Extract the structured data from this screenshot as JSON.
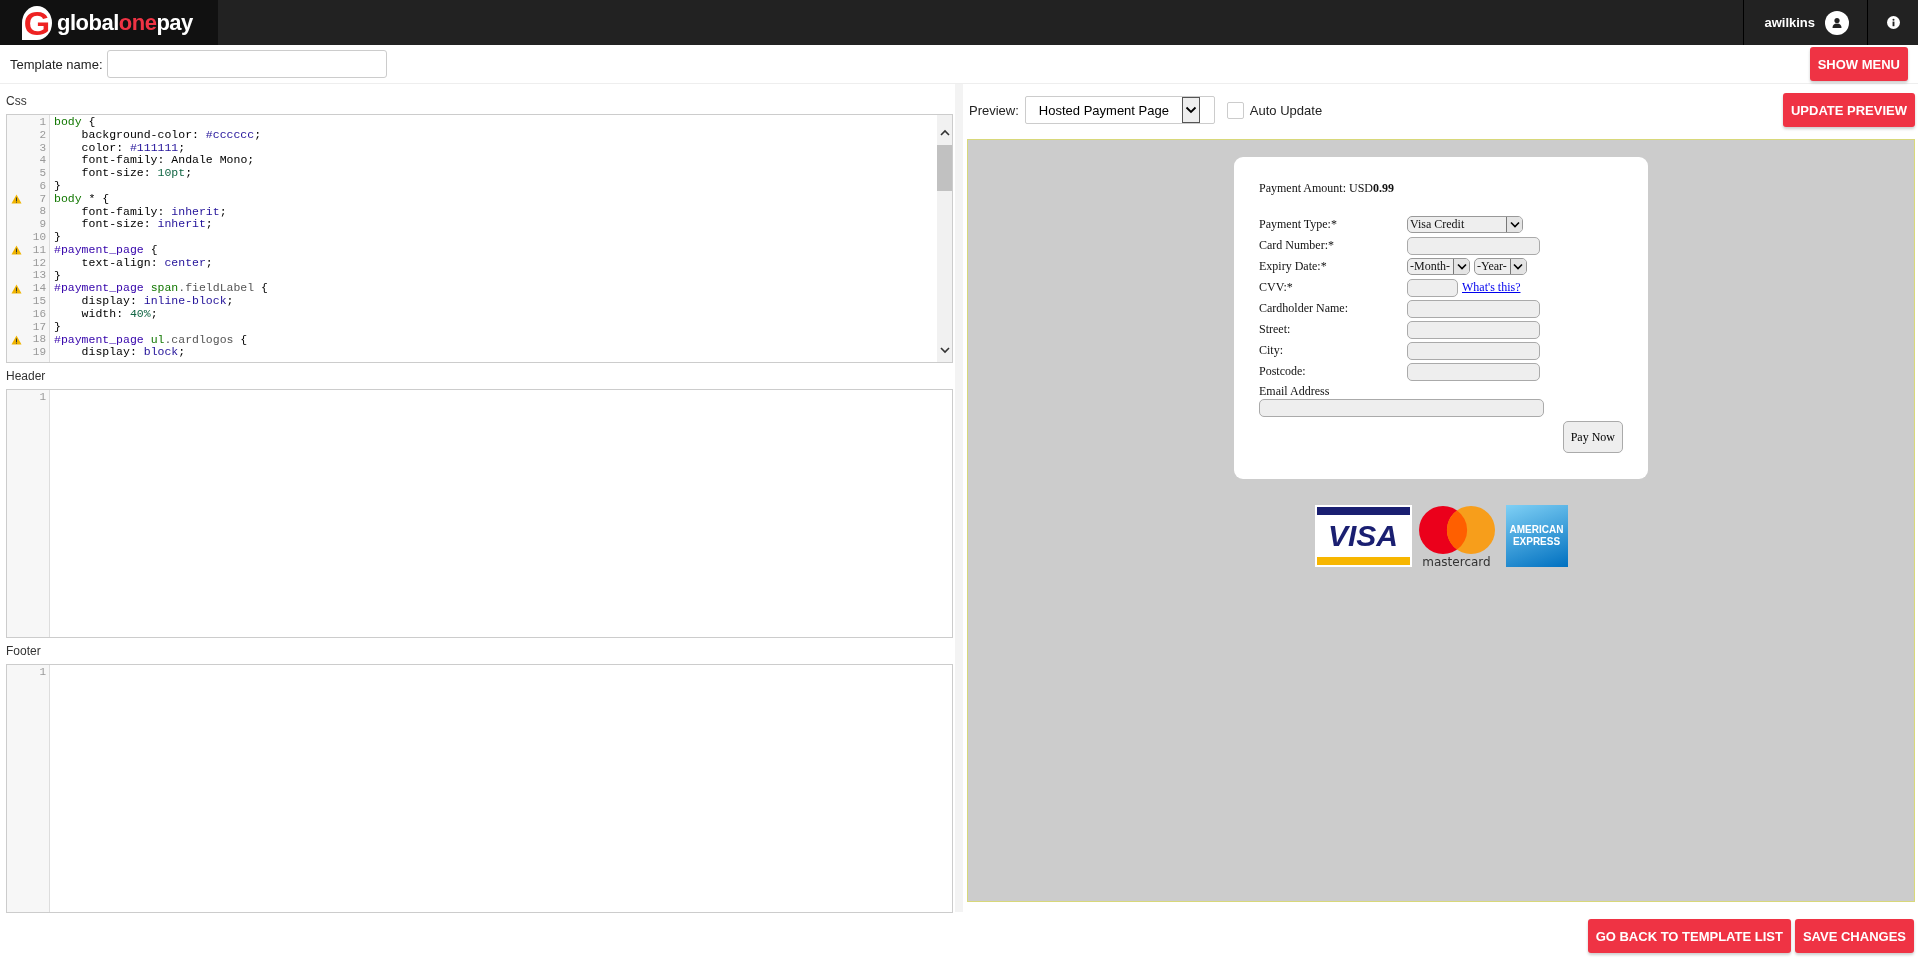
{
  "brand": {
    "logo_letter": "G",
    "parts": [
      {
        "text": "global",
        "accent": false
      },
      {
        "text": "one",
        "accent": true
      },
      {
        "text": "pay",
        "accent": false
      }
    ]
  },
  "user": {
    "name": "awilkins"
  },
  "template": {
    "label": "Template name:"
  },
  "show_menu": "SHOW MENU",
  "editors": [
    {
      "title": "Css",
      "scrollbar": true,
      "lines": [
        {
          "n": "1",
          "warning": false,
          "text": "body {"
        },
        {
          "n": "2",
          "warning": false,
          "text": "    background-color: #cccccc;"
        },
        {
          "n": "3",
          "warning": false,
          "text": "    color: #111111;"
        },
        {
          "n": "4",
          "warning": false,
          "text": "    font-family: Andale Mono;"
        },
        {
          "n": "5",
          "warning": false,
          "text": "    font-size: 10pt;"
        },
        {
          "n": "6",
          "warning": false,
          "text": "}"
        },
        {
          "n": "7",
          "warning": true,
          "text": "body * {"
        },
        {
          "n": "8",
          "warning": false,
          "text": "    font-family: inherit;"
        },
        {
          "n": "9",
          "warning": false,
          "text": "    font-size: inherit;"
        },
        {
          "n": "10",
          "warning": false,
          "text": "}"
        },
        {
          "n": "11",
          "warning": true,
          "text": "#payment_page {"
        },
        {
          "n": "12",
          "warning": false,
          "text": "    text-align: center;"
        },
        {
          "n": "13",
          "warning": false,
          "text": "}"
        },
        {
          "n": "14",
          "warning": true,
          "text": "#payment_page span.fieldLabel {"
        },
        {
          "n": "15",
          "warning": false,
          "text": "    display: inline-block;"
        },
        {
          "n": "16",
          "warning": false,
          "text": "    width: 40%;"
        },
        {
          "n": "17",
          "warning": false,
          "text": "}"
        },
        {
          "n": "18",
          "warning": true,
          "text": "#payment_page ul.cardlogos {"
        },
        {
          "n": "19",
          "warning": false,
          "text": "    display: block;"
        }
      ]
    },
    {
      "title": "Header",
      "scrollbar": false,
      "lines": [
        {
          "n": "1",
          "warning": false
        }
      ]
    },
    {
      "title": "Footer",
      "scrollbar": false,
      "lines": [
        {
          "n": "1",
          "warning": false
        }
      ]
    }
  ],
  "preview": {
    "label": "Preview:",
    "selected": "Hosted Payment Page",
    "auto_update": {
      "label": "Auto Update",
      "checked": false
    },
    "update_button": "UPDATE PREVIEW"
  },
  "payment_form": {
    "amount_label": "Payment Amount: USD",
    "amount": "0.99",
    "fields": [
      {
        "kind": "select",
        "label": "Payment Type:*",
        "value": "Visa Credit"
      },
      {
        "kind": "text",
        "label": "Card Number:*"
      },
      {
        "kind": "expiry",
        "label": "Expiry Date:*",
        "month": "-Month-",
        "year": "-Year-"
      },
      {
        "kind": "cvv",
        "label": "CVV:*",
        "link": "What's this?"
      },
      {
        "kind": "text",
        "label": "Cardholder Name:"
      },
      {
        "kind": "text",
        "label": "Street:"
      },
      {
        "kind": "text",
        "label": "City:"
      },
      {
        "kind": "text",
        "label": "Postcode:"
      },
      {
        "kind": "wide",
        "label": "Email Address"
      }
    ],
    "submit": "Pay Now"
  },
  "card_logos": [
    {
      "kind": "visa",
      "text": "VISA"
    },
    {
      "kind": "mastercard",
      "text": "mastercard"
    },
    {
      "kind": "amex",
      "text": "AMERICAN EXPRESS"
    }
  ],
  "footer_buttons": [
    "GO BACK TO TEMPLATE LIST",
    "SAVE CHANGES"
  ]
}
